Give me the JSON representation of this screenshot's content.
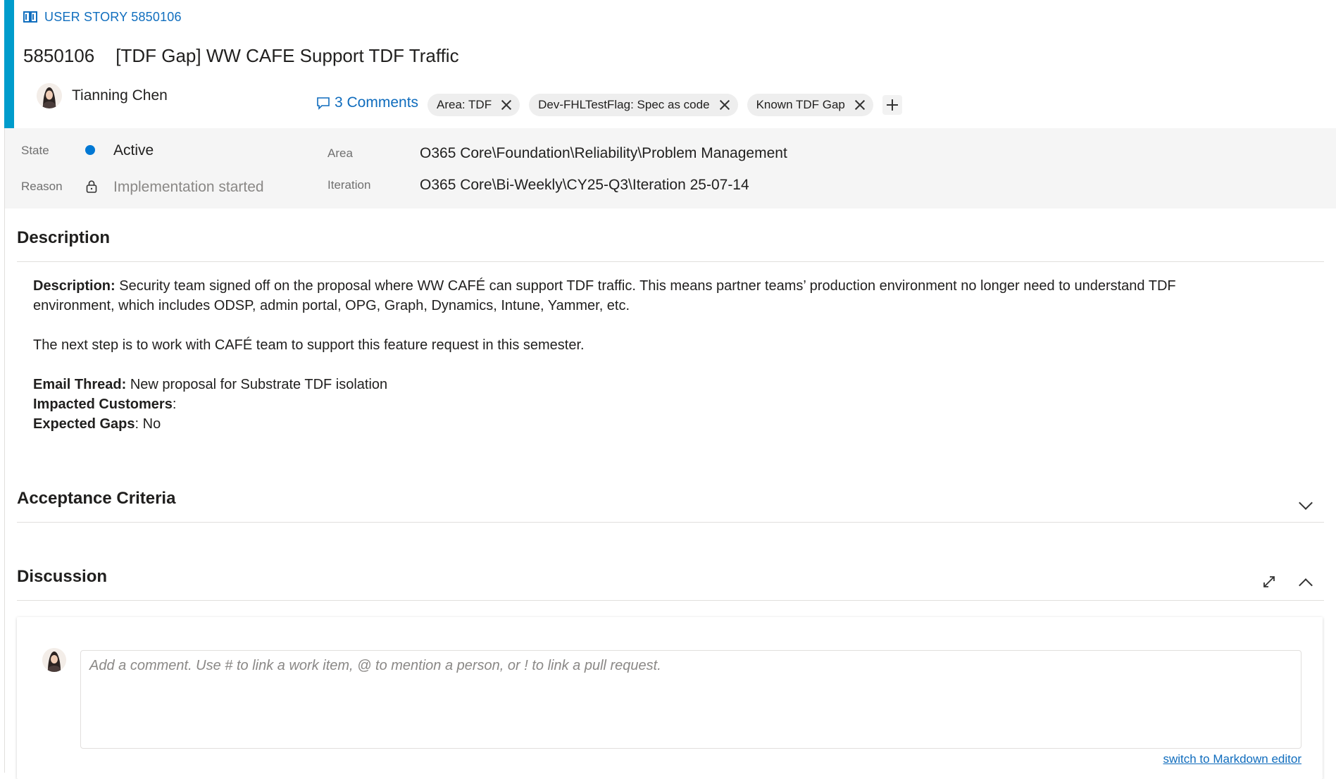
{
  "header": {
    "type_label": "USER STORY 5850106",
    "work_item_id": "5850106",
    "title": "[TDF Gap] WW CAFE Support TDF Traffic",
    "assignee": "Tianning Chen",
    "comments_label": "3 Comments",
    "accent_color": "#009ccc"
  },
  "tags": [
    {
      "label": "Area: TDF"
    },
    {
      "label": "Dev-FHLTestFlag: Spec as code"
    },
    {
      "label": "Known TDF Gap"
    }
  ],
  "fields": {
    "state_label": "State",
    "state_value": "Active",
    "reason_label": "Reason",
    "reason_value": "Implementation started",
    "area_label": "Area",
    "area_value": "O365 Core\\Foundation\\Reliability\\Problem Management",
    "iteration_label": "Iteration",
    "iteration_value": "O365 Core\\Bi-Weekly\\CY25-Q3\\Iteration 25-07-14",
    "state_color": "#0078d4"
  },
  "description": {
    "section_title": "Description",
    "desc_label": "Description:",
    "desc_text": " Security team signed off on the proposal where WW CAFÉ can support TDF traffic. This means partner teams’ production environment no longer need to understand TDF environment, which includes ODSP, admin portal, OPG, Graph, Dynamics, Intune, Yammer, etc.",
    "next_step": "The next step is to work with CAFÉ team to support this feature request in this semester.",
    "email_label": "Email Thread:",
    "email_value": " New proposal for Substrate TDF isolation",
    "impacted_label": "Impacted Customers",
    "impacted_value": ":",
    "gaps_label": "Expected Gaps",
    "gaps_value": ": No"
  },
  "acceptance": {
    "section_title": "Acceptance Criteria"
  },
  "discussion": {
    "section_title": "Discussion",
    "comment_placeholder": "Add a comment. Use # to link a work item, @ to mention a person, or ! to link a pull request.",
    "markdown_link": "switch to Markdown editor"
  },
  "icons": [
    "book-icon",
    "comment-icon",
    "close-icon",
    "add-icon",
    "lock-icon",
    "chevron-down-icon",
    "expand-icon",
    "chevron-up-icon"
  ]
}
